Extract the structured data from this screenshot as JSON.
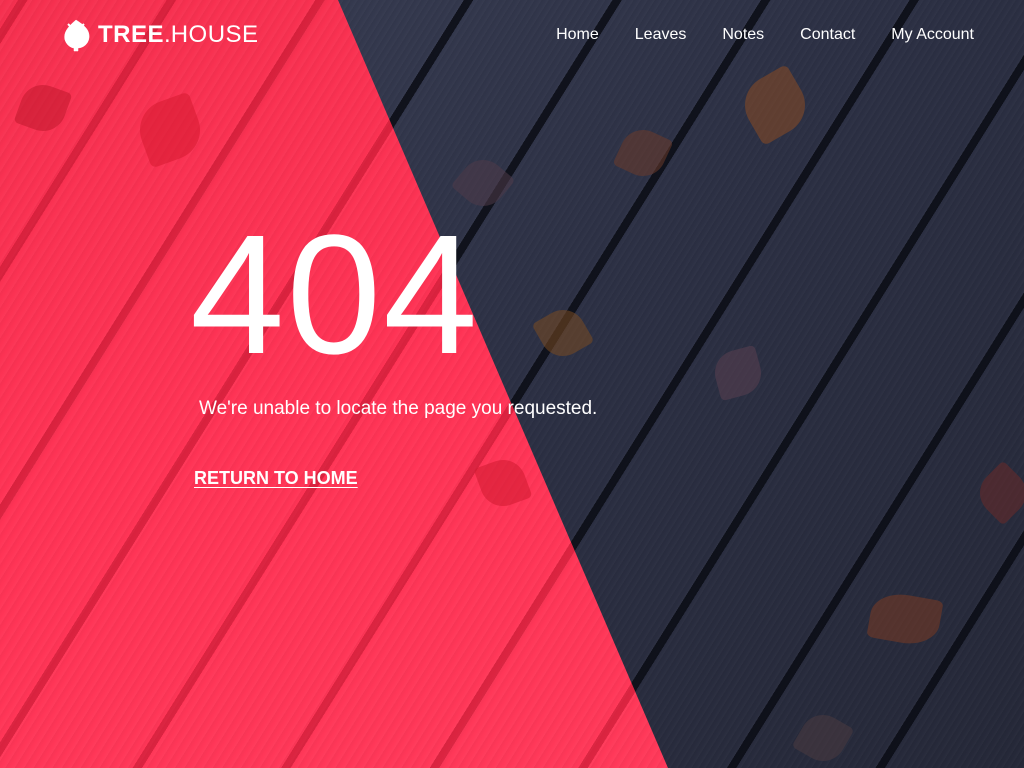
{
  "brand": {
    "name_bold": "TREE",
    "name_separator": ".",
    "name_light": "HOUSE",
    "logo_icon": "leaf-icon"
  },
  "nav": {
    "items": [
      {
        "label": "Home"
      },
      {
        "label": "Leaves"
      },
      {
        "label": "Notes"
      },
      {
        "label": "Contact"
      },
      {
        "label": "My Account"
      }
    ]
  },
  "error": {
    "code": "404",
    "message": "We're unable to locate the page you requested.",
    "return_label": "RETURN TO HOME"
  },
  "colors": {
    "accent_red": "#ff3355",
    "dark_background": "#2c3044",
    "text": "#ffffff"
  }
}
